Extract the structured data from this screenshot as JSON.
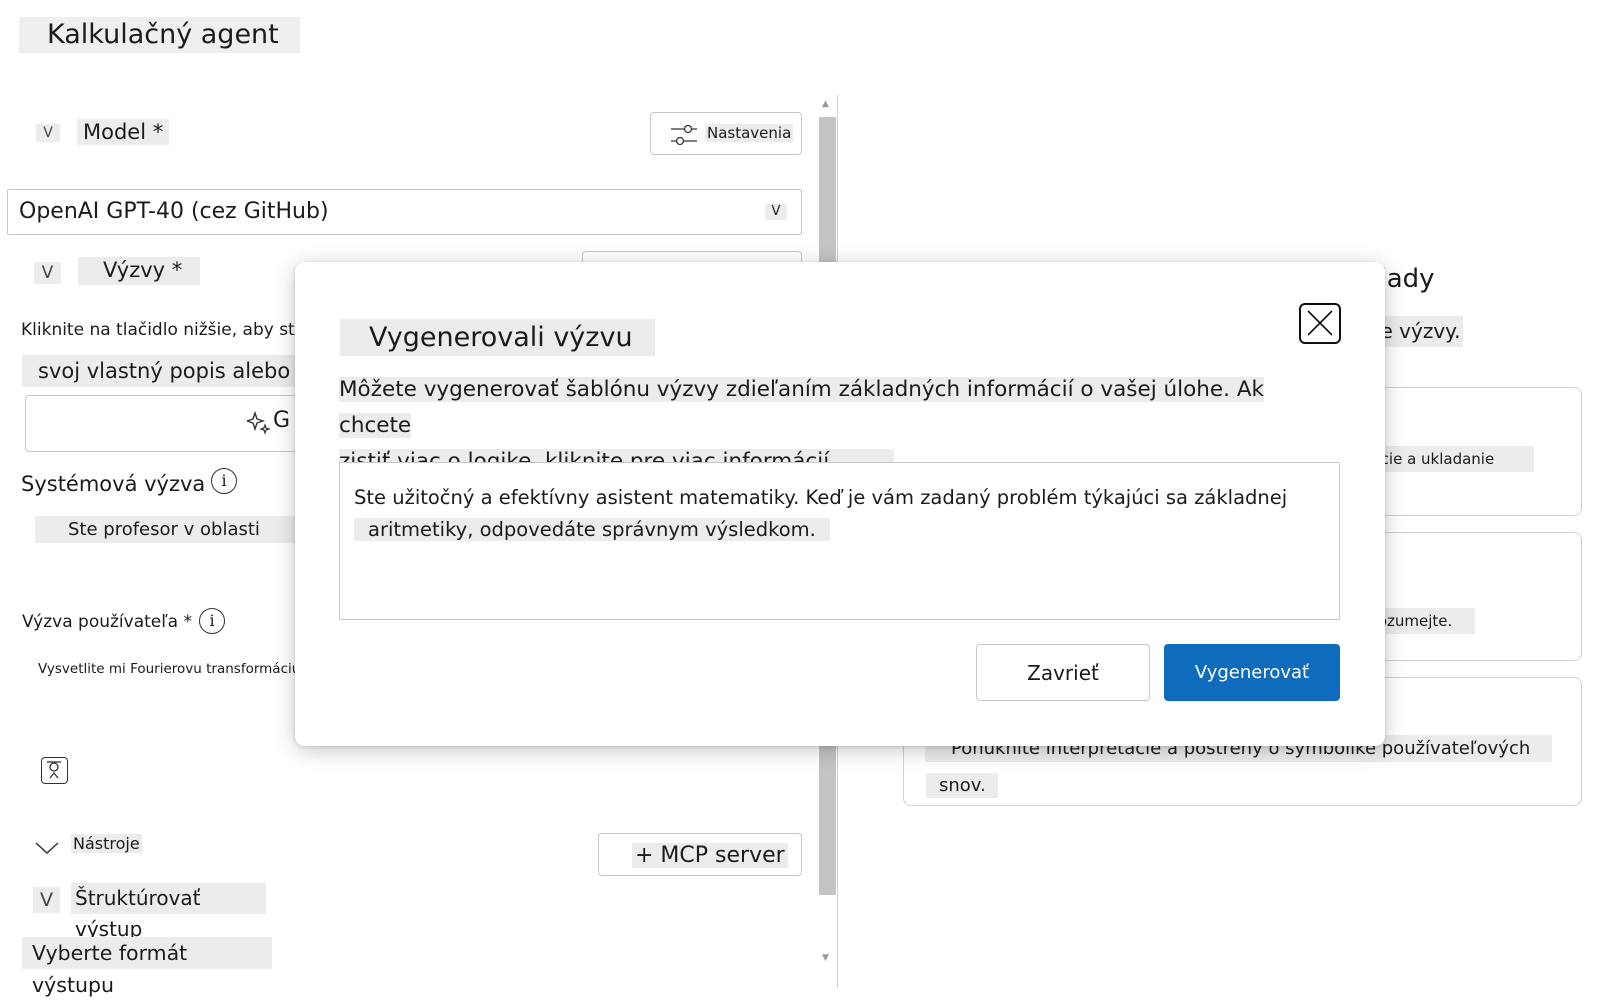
{
  "app_title": "Kalkulačný agent",
  "model_section": {
    "chevron": "V",
    "label": "Model *",
    "settings_button": "Nastavenia",
    "selected_model": "OpenAI GPT-40 (cez GitHub)",
    "select_caret": "V"
  },
  "prompts_section": {
    "chevron": "V",
    "label": "Výzvy *",
    "instruction_line1": "Kliknite na tlačidlo nižšie, aby ste",
    "instruction_line2": "svoj vlastný popis alebo",
    "generate_button_partial": "G"
  },
  "system_prompt": {
    "label": "Systémová výzva",
    "info": "i",
    "value": "Ste profesor v oblasti"
  },
  "user_prompt": {
    "label": "Výzva používateľa *",
    "info": "i",
    "value": "Vysvetlite mi Fourierovu transformáciu"
  },
  "tools_section": {
    "label": "Nástroje",
    "mcp_button": "+ MCP server"
  },
  "structured_output": {
    "chevron": "V",
    "label": "Štruktúrovať výstup",
    "format_label": "Vyberte formát výstupu"
  },
  "examples_panel": {
    "heading_partial": "príklady",
    "subtitle_partial": "vaše výzvy.",
    "cards": [
      {
        "text": "aplikácie a ukladanie"
      },
      {
        "text": "rozumejte."
      },
      {
        "text_line1": "Ponúknite interpretácie a postrehy o symbolike používateľových",
        "text_line2": "snov."
      }
    ]
  },
  "modal": {
    "title": "Vygenerovali výzvu",
    "description_line1": "Môžete vygenerovať šablónu výzvy zdieľaním základných informácií o vašej úlohe. Ak chcete",
    "description_line2": "zistiť viac o logike, kliknite pre viac informácií.",
    "prompt_line1": "Ste užitočný a efektívny asistent matematiky. Keď je vám zadaný problém týkajúci sa základnej",
    "prompt_line2": "aritmetiky, odpovedáte správnym výsledkom.",
    "cancel_button": "Zavrieť",
    "generate_button": "Vygenerovať"
  },
  "colors": {
    "primary": "#0f6cbd",
    "highlight": "#ececec",
    "border": "#c8c8c8"
  }
}
